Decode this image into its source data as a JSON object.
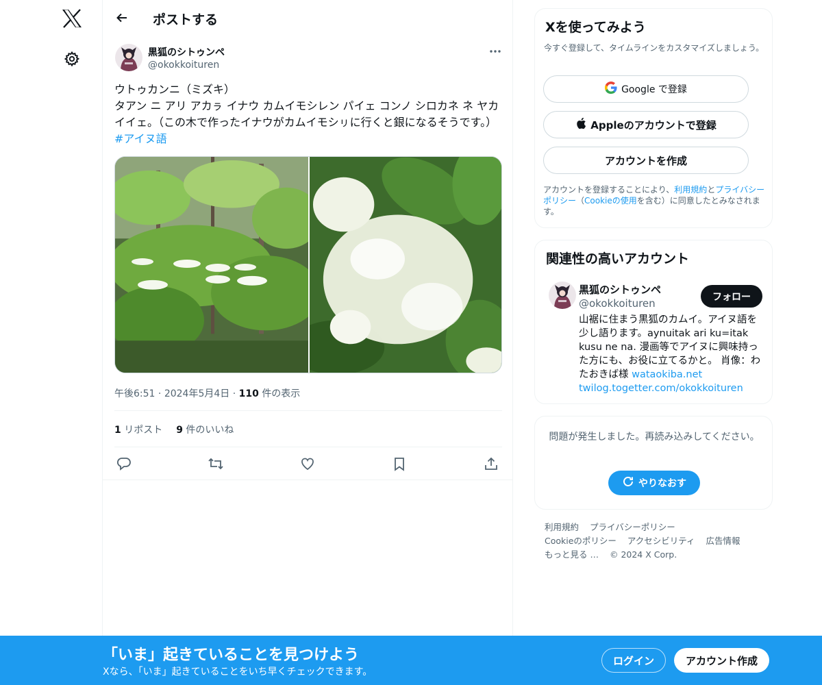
{
  "colors": {
    "accent": "#1d9bf0",
    "text": "#0f1419",
    "muted": "#536471",
    "border": "#eff3f4"
  },
  "nav": {
    "logo_icon": "x-logo-icon",
    "settings_icon": "gear-icon"
  },
  "header": {
    "back_icon": "arrow-left-icon",
    "title": "ポストする"
  },
  "post": {
    "author_name": "黒狐のシトゥンペ",
    "author_handle": "@okokkoituren",
    "more_icon": "ellipsis-icon",
    "text_line1": "ウトゥカンニ（ミズキ）",
    "text_body": "タアン ニ アリ アカㇻ イナウ カムイモシレン パイェ コンノ シロカネ ネ ヤカイイェ。（この木で作ったイナウがカムイモシㇼに行くと銀になるそうです。）",
    "hashtag": "#アイヌ語",
    "images": [
      "dogwood-tree-photo",
      "dogwood-flowers-closeup-photo"
    ],
    "time": "午後6:51",
    "sep": "·",
    "date": "2024年5月4日",
    "views_count": "110",
    "views_label": "件の表示",
    "reposts_count": "1",
    "reposts_label": "リポスト",
    "likes_count": "9",
    "likes_label": "件のいいね",
    "actions": [
      "reply-icon",
      "repost-icon",
      "like-icon",
      "bookmark-icon",
      "share-icon"
    ]
  },
  "signup_card": {
    "title": "Xを使ってみよう",
    "subtitle": "今すぐ登録して、タイムラインをカスタマイズしましょう。",
    "google_label": "Google で登録",
    "apple_label": "Appleのアカウントで登録",
    "create_label": "アカウントを作成",
    "terms_prefix": "アカウントを登録することにより、",
    "terms_link": "利用規約",
    "terms_and": "と",
    "privacy_link": "プライバシーポリシー",
    "terms_mid": "（",
    "cookie_link": "Cookieの使用",
    "terms_suffix": "を含む）に同意したとみなされます。"
  },
  "related": {
    "title": "関連性の高いアカウント",
    "name": "黒狐のシトゥンペ",
    "handle": "@okokkoituren",
    "follow_label": "フォロー",
    "bio": "山裾に住まう黒狐のカムイ。アイヌ語を少し語ります。aynuitak ari ku=itak kusu ne na. 漫画等でアイヌに興味持った方にも、お役に立てるかと。 肖像：わたおきば様",
    "link1": "wataokiba.net",
    "link2": "twilog.togetter.com/okokkoituren"
  },
  "error_card": {
    "message": "問題が発生しました。再読み込みしてください。",
    "retry_label": "やりなおす"
  },
  "footer": {
    "links_row1": [
      "利用規約",
      "プライバシーポリシー"
    ],
    "links_row2": [
      "Cookieのポリシー",
      "アクセシビリティ",
      "広告情報"
    ],
    "more": "もっと見る …",
    "copyright": "© 2024 X Corp."
  },
  "banner": {
    "heading": "「いま」起きていることを見つけよう",
    "subheading": "Xなら、「いま」起きていることをいち早くチェックできます。",
    "login_label": "ログイン",
    "signup_label": "アカウント作成"
  }
}
